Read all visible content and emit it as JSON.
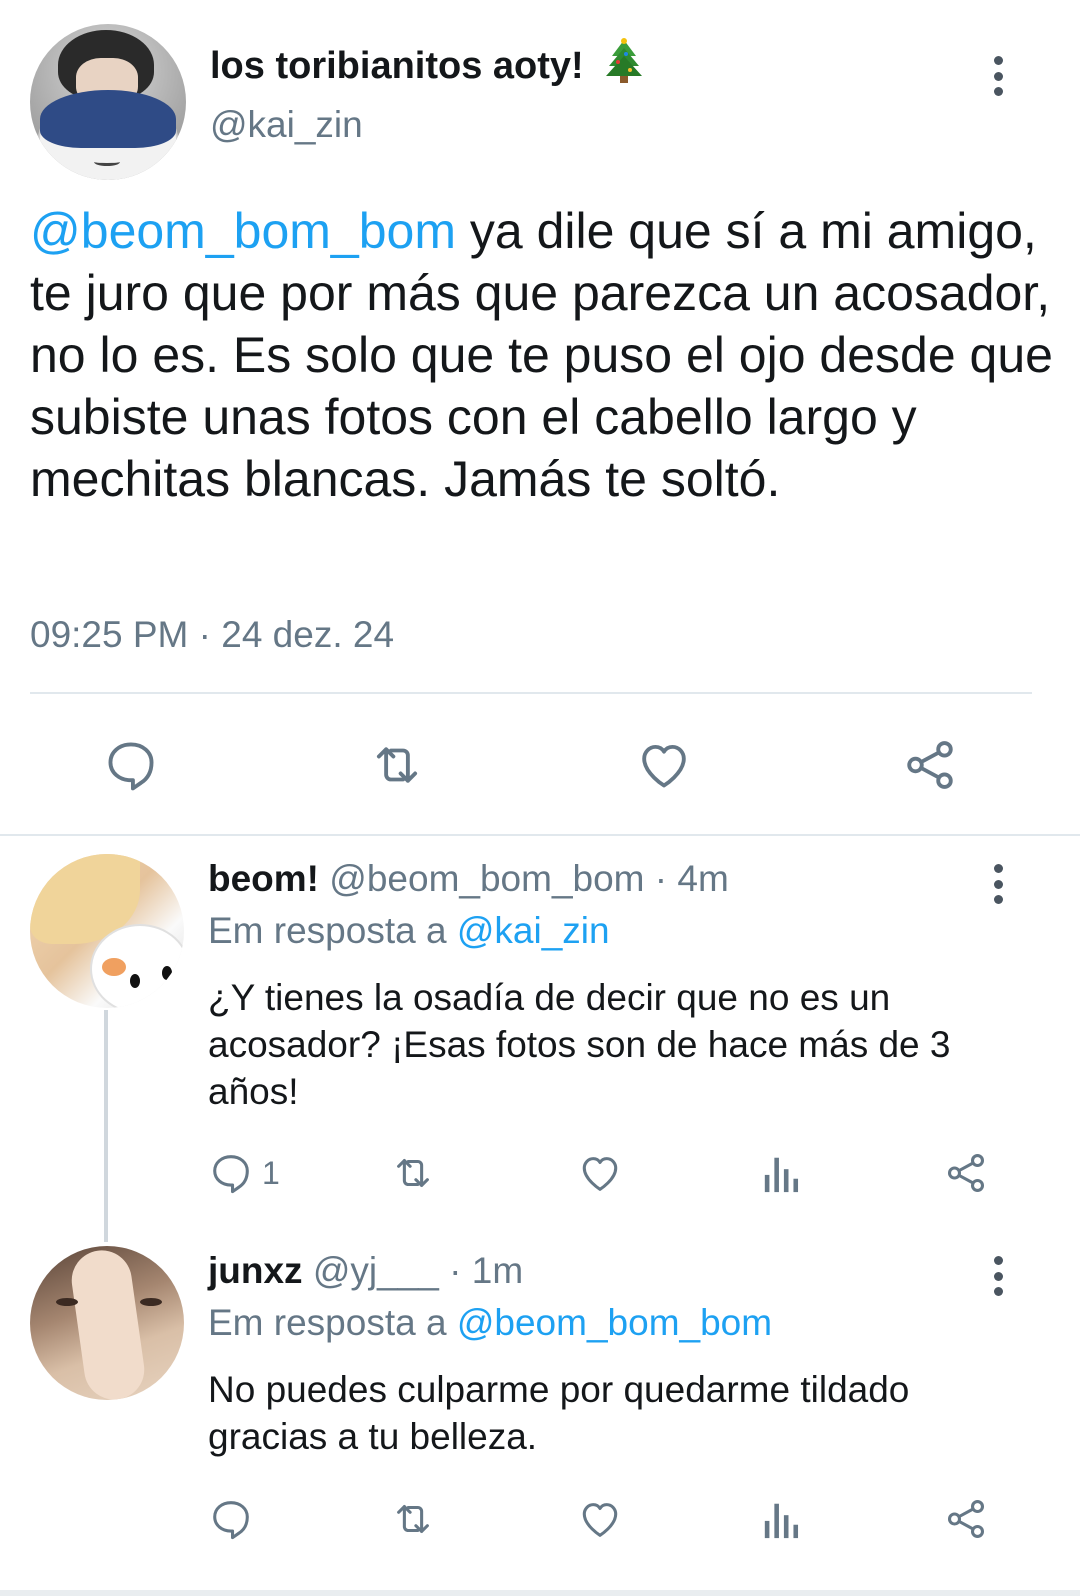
{
  "main_tweet": {
    "display_name": "los toribianitos aoty!",
    "handle": "@kai_zin",
    "mention": "@beom_bom_bom",
    "text": " ya dile que sí a mi amigo, te juro que por más que parezca un acosador, no lo es. Es solo que te puso el ojo desde que subiste unas fotos con el cabello largo y mechitas blancas. Jamás te soltó.",
    "timestamp": "09:25 PM · 24 dez. 24",
    "emoji_icon": "christmas-tree-icon",
    "actions": [
      "reply-icon",
      "retweet-icon",
      "like-icon",
      "share-icon"
    ]
  },
  "replies": [
    {
      "display_name": "beom!",
      "handle": "@beom_bom_bom",
      "time": "· 4m",
      "reply_prefix": "Em resposta a ",
      "reply_to": "@kai_zin",
      "text": "¿Y tienes la osadía de decir que no es un acosador? ¡Esas fotos son de hace más de 3 años!",
      "reply_count": "1",
      "actions": [
        "reply-icon",
        "retweet-icon",
        "like-icon",
        "analytics-icon",
        "share-icon"
      ]
    },
    {
      "display_name": "junxz",
      "handle": "@yj___",
      "time": "· 1m",
      "reply_prefix": "Em resposta a ",
      "reply_to": "@beom_bom_bom",
      "text": "No puedes culparme por quedarme tildado gracias a tu belleza.",
      "actions": [
        "reply-icon",
        "retweet-icon",
        "like-icon",
        "analytics-icon",
        "share-icon"
      ]
    }
  ],
  "colors": {
    "link": "#1da1f2",
    "secondary_text": "#657786",
    "primary_text": "#14171a",
    "icon": "#657786",
    "divider": "#e1e8ed"
  }
}
